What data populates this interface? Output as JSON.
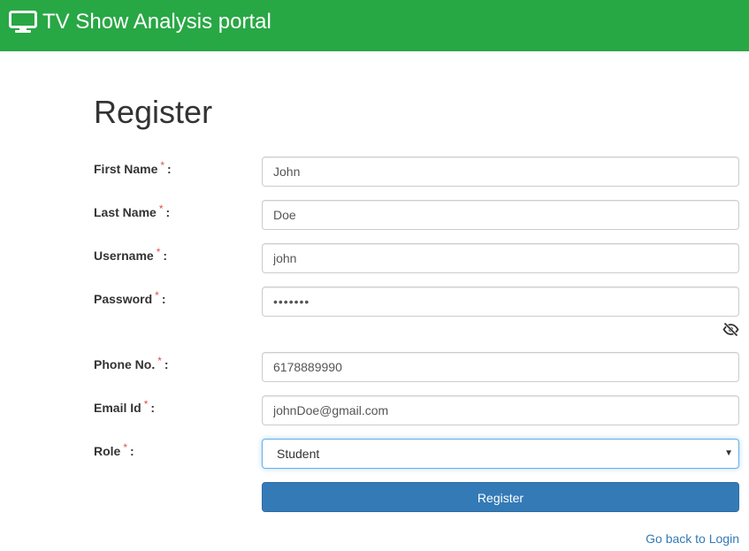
{
  "navbar": {
    "icon": "monitor-icon",
    "brand": "TV Show Analysis portal",
    "background": "#28a745"
  },
  "page": {
    "title": "Register"
  },
  "form": {
    "required_mark": "*",
    "separator": ":",
    "fields": [
      {
        "label": "First Name",
        "value": "John"
      },
      {
        "label": "Last Name",
        "value": "Doe"
      },
      {
        "label": "Username",
        "value": "john"
      },
      {
        "label": "Password",
        "value": "•••••••"
      },
      {
        "label": "Phone No.",
        "value": "6178889990"
      },
      {
        "label": "Email Id",
        "value": "johnDoe@gmail.com"
      },
      {
        "label": "Role",
        "value": "Student"
      }
    ],
    "password_toggle_icon": "eye-slash-icon",
    "submit_label": "Register",
    "back_link": "Go back to Login",
    "accent_color": "#337ab7"
  }
}
